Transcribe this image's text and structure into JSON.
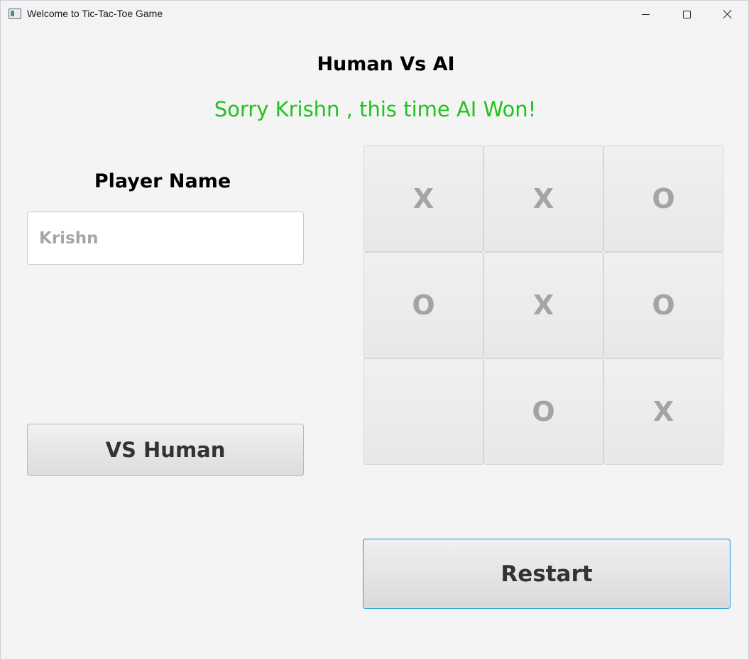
{
  "window": {
    "title": "Welcome to Tic-Tac-Toe Game"
  },
  "game": {
    "mode_title": "Human Vs AI",
    "status_message": "Sorry Krishn , this time AI Won!",
    "status_color": "#1fc21f"
  },
  "player": {
    "label": "Player Name",
    "name_placeholder": "Krishn"
  },
  "buttons": {
    "vs_human": "VS Human",
    "restart": "Restart"
  },
  "board": {
    "cells": [
      "X",
      "X",
      "O",
      "O",
      "X",
      "O",
      "",
      "O",
      "X"
    ]
  }
}
